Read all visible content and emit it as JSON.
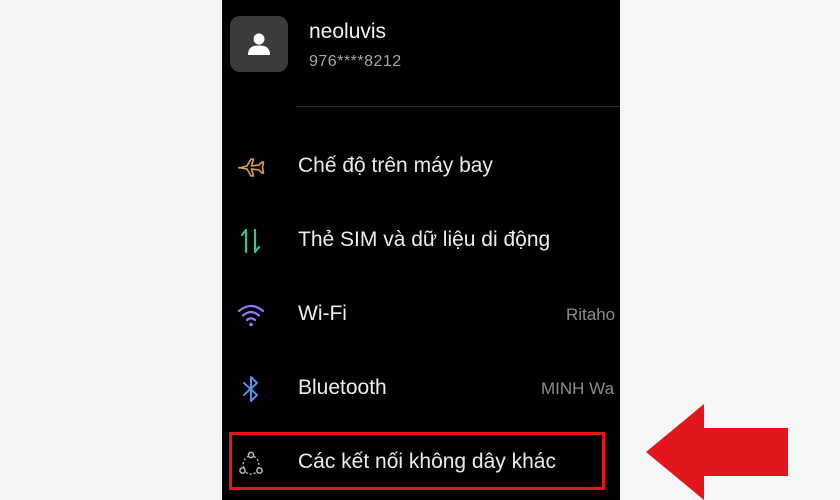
{
  "profile": {
    "name": "neoluvis",
    "phone": "976****8212",
    "avatar_icon": "person-icon"
  },
  "settings": [
    {
      "label": "Chế độ trên máy bay",
      "value": "",
      "icon": "airplane-icon",
      "color": "#e0a34a"
    },
    {
      "label": "Thẻ SIM và dữ liệu di động",
      "value": "",
      "icon": "mobile-data-icon",
      "color": "#3cc28a"
    },
    {
      "label": "Wi-Fi",
      "value": "Ritaho",
      "icon": "wifi-icon",
      "color": "#8a7df2"
    },
    {
      "label": "Bluetooth",
      "value": "MINH Wa",
      "icon": "bluetooth-icon",
      "color": "#5b8ef0"
    },
    {
      "label": "Các kết nối không dây khác",
      "value": "",
      "icon": "wireless-connections-icon",
      "color": "#b9b9c9"
    }
  ],
  "annotation": {
    "highlight_color": "#e3161b",
    "arrow_color": "#e3161b",
    "arrow_direction": "left"
  }
}
